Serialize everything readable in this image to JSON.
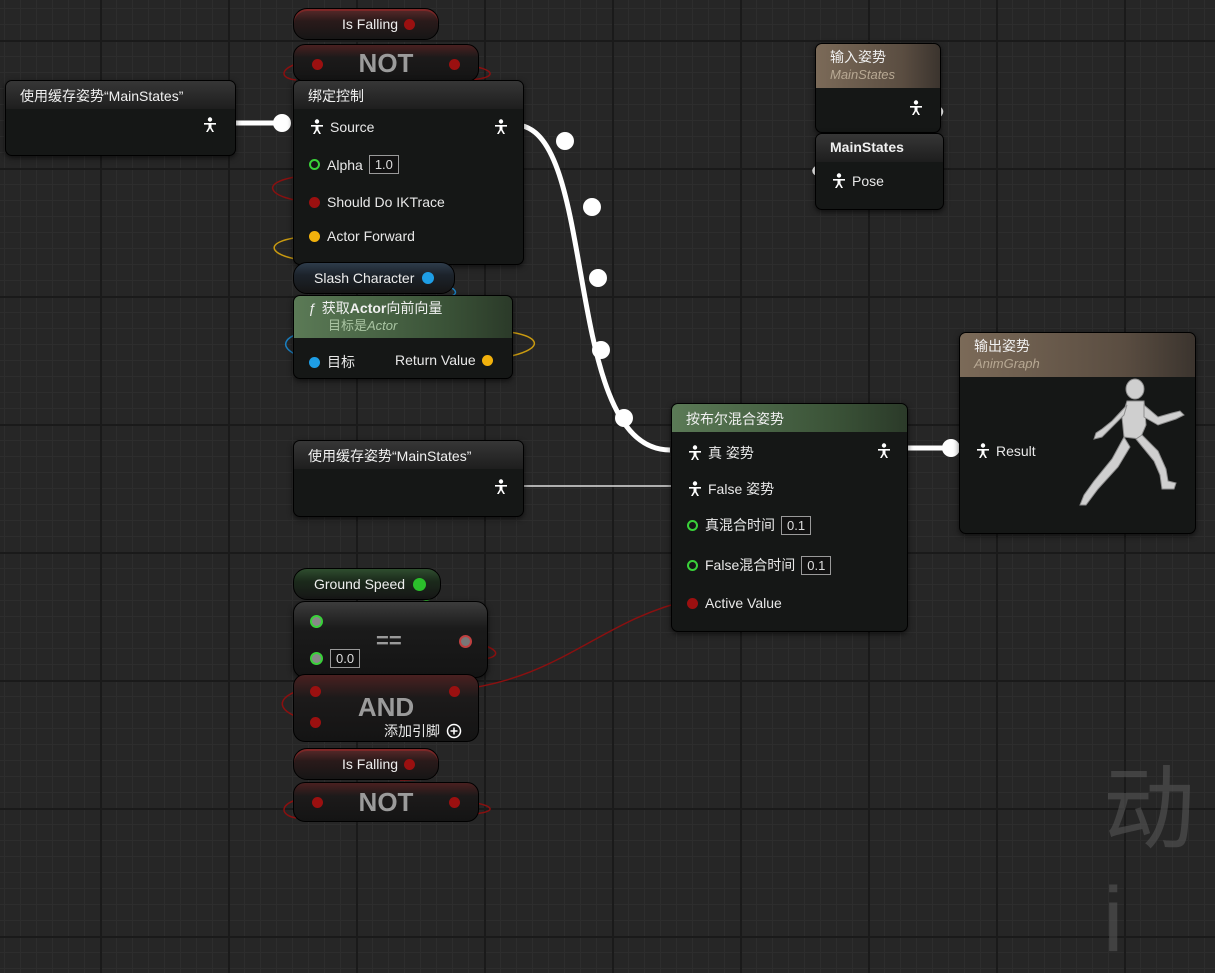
{
  "cached_pose_top": {
    "title": "使用缓存姿势“MainStates”"
  },
  "cached_pose_mid": {
    "title": "使用缓存姿势“MainStates”"
  },
  "is_falling_top": {
    "label": "Is Falling"
  },
  "not_top": {
    "label": "NOT"
  },
  "bind_control": {
    "title": "绑定控制",
    "source_label": "Source",
    "alpha_label": "Alpha",
    "alpha_value": "1.0",
    "should_do_ik_label": "Should Do IKTrace",
    "actor_forward_label": "Actor Forward"
  },
  "slash_character": {
    "label": "Slash Character"
  },
  "get_forward": {
    "title_pre": "获取",
    "title_bold": "Actor",
    "title_post": "向前向量",
    "subtitle_pre": "目标是",
    "subtitle_italic": "Actor",
    "target_label": "目标",
    "return_label": "Return Value"
  },
  "input_pose": {
    "title": "输入姿势",
    "subtitle": "MainStates"
  },
  "main_states": {
    "title": "MainStates",
    "pose_label": "Pose"
  },
  "output_pose": {
    "title": "输出姿势",
    "subtitle": "AnimGraph",
    "result_label": "Result"
  },
  "blend_by_bool": {
    "title": "按布尔混合姿势",
    "true_pose_label": "真 姿势",
    "false_pose_label": "False 姿势",
    "true_blend_label": "真混合时间",
    "true_blend_value": "0.1",
    "false_blend_label": "False混合时间",
    "false_blend_value": "0.1",
    "active_label": "Active Value"
  },
  "ground_speed": {
    "label": "Ground Speed"
  },
  "equals": {
    "operator": "==",
    "value": "0.0"
  },
  "and_node": {
    "label": "AND",
    "add_pin_label": "添加引脚"
  },
  "is_falling_bottom": {
    "label": "Is Falling"
  },
  "not_bottom": {
    "label": "NOT"
  },
  "watermark": {
    "text": "动i"
  },
  "colors": {
    "exec_white": "#ffffff",
    "bool_red": "#9b1010",
    "float_green": "#2bbf2b",
    "object_blue": "#1e9ee6",
    "vector_yellow": "#f1b10c"
  }
}
